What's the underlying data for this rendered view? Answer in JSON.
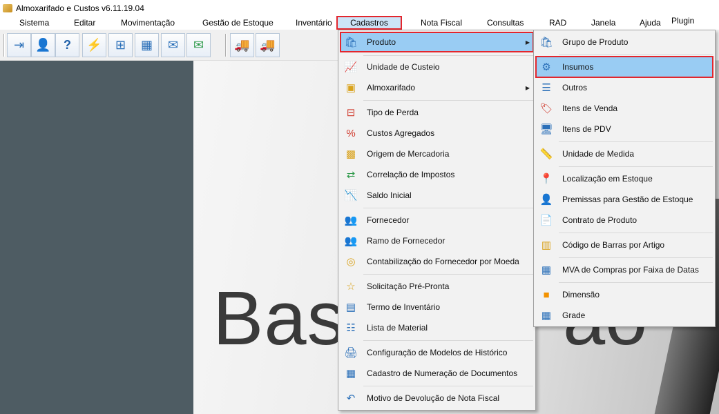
{
  "window": {
    "title": "Almoxarifado e Custos v6.11.19.04"
  },
  "menubar": [
    {
      "label": "Sistema"
    },
    {
      "label": "Editar"
    },
    {
      "label": "Movimentação"
    },
    {
      "label": "Gestão de Estoque"
    },
    {
      "label": "Inventário"
    },
    {
      "label": "Cadastros"
    },
    {
      "label": "Nota Fiscal"
    },
    {
      "label": "Consultas"
    },
    {
      "label": "RAD"
    },
    {
      "label": "Janela"
    },
    {
      "label": "Ajuda"
    },
    {
      "label": "Plugin"
    }
  ],
  "toolbar": [
    {
      "icon": "exit-icon"
    },
    {
      "icon": "user-icon"
    },
    {
      "icon": "help-icon"
    },
    {
      "icon": "lightning-icon"
    },
    {
      "icon": "org-chart-icon"
    },
    {
      "icon": "calculator-icon"
    },
    {
      "icon": "envelope-icon"
    },
    {
      "icon": "envelope-send-icon"
    },
    {
      "icon": "truck-remove-icon"
    },
    {
      "icon": "truck-box-icon"
    }
  ],
  "splash": {
    "text_left": "Bas",
    "text_right": "ao"
  },
  "cadastros_menu": [
    {
      "label": "Produto",
      "icon": "product-box-icon",
      "submenu": true
    },
    {
      "label": "Unidade de Custeio",
      "icon": "chart-icon"
    },
    {
      "label": "Almoxarifado",
      "icon": "boxes-icon",
      "submenu": true
    },
    {
      "label": "Tipo de Perda",
      "icon": "loss-icon"
    },
    {
      "label": "Custos Agregados",
      "icon": "percent-icon"
    },
    {
      "label": "Origem de Mercadoria",
      "icon": "origin-icon"
    },
    {
      "label": "Correlação de Impostos",
      "icon": "tax-icon"
    },
    {
      "label": "Saldo Inicial",
      "icon": "balance-chart-icon"
    },
    {
      "label": "Fornecedor",
      "icon": "supplier-icon"
    },
    {
      "label": "Ramo de Fornecedor",
      "icon": "supplier-branch-icon"
    },
    {
      "label": "Contabilização do Fornecedor por Moeda",
      "icon": "coins-icon"
    },
    {
      "label": "Solicitação Pré-Pronta",
      "icon": "request-icon"
    },
    {
      "label": "Termo de Inventário",
      "icon": "inventory-doc-icon"
    },
    {
      "label": "Lista de Material",
      "icon": "material-list-icon"
    },
    {
      "label": "Configuração de Modelos de Histórico",
      "icon": "printer-icon"
    },
    {
      "label": "Cadastro de Numeração de Documentos",
      "icon": "numbering-icon"
    },
    {
      "label": "Motivo de Devolução de Nota Fiscal",
      "icon": "return-icon"
    }
  ],
  "produto_submenu": [
    {
      "label": "Grupo de Produto",
      "icon": "product-group-icon"
    },
    {
      "label": "Insumos",
      "icon": "inputs-icon"
    },
    {
      "label": "Outros",
      "icon": "others-icon"
    },
    {
      "label": "Itens de Venda",
      "icon": "price-tag-icon"
    },
    {
      "label": "Itens de PDV",
      "icon": "pos-monitor-icon"
    },
    {
      "label": "Unidade de Medida",
      "icon": "ruler-icon"
    },
    {
      "label": "Localização em Estoque",
      "icon": "location-pin-icon"
    },
    {
      "label": "Premissas para Gestão de Estoque",
      "icon": "premises-icon"
    },
    {
      "label": "Contrato de Produto",
      "icon": "contract-icon"
    },
    {
      "label": "Código de Barras por Artigo",
      "icon": "barcode-icon"
    },
    {
      "label": "MVA de Compras por Faixa de Datas",
      "icon": "calendar-percent-icon"
    },
    {
      "label": "Dimensão",
      "icon": "dimension-icon"
    },
    {
      "label": "Grade",
      "icon": "grid-icon"
    }
  ]
}
